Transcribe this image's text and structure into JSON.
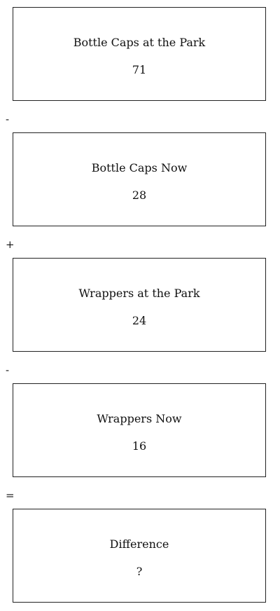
{
  "steps": [
    {
      "label": "Bottle Caps at the Park",
      "value": "71"
    },
    {
      "label": "Bottle Caps Now",
      "value": "28"
    },
    {
      "label": "Wrappers at the Park",
      "value": "24"
    },
    {
      "label": "Wrappers Now",
      "value": "16"
    },
    {
      "label": "Difference",
      "value": "?"
    }
  ],
  "operators": [
    "-",
    "+",
    "-",
    "="
  ]
}
